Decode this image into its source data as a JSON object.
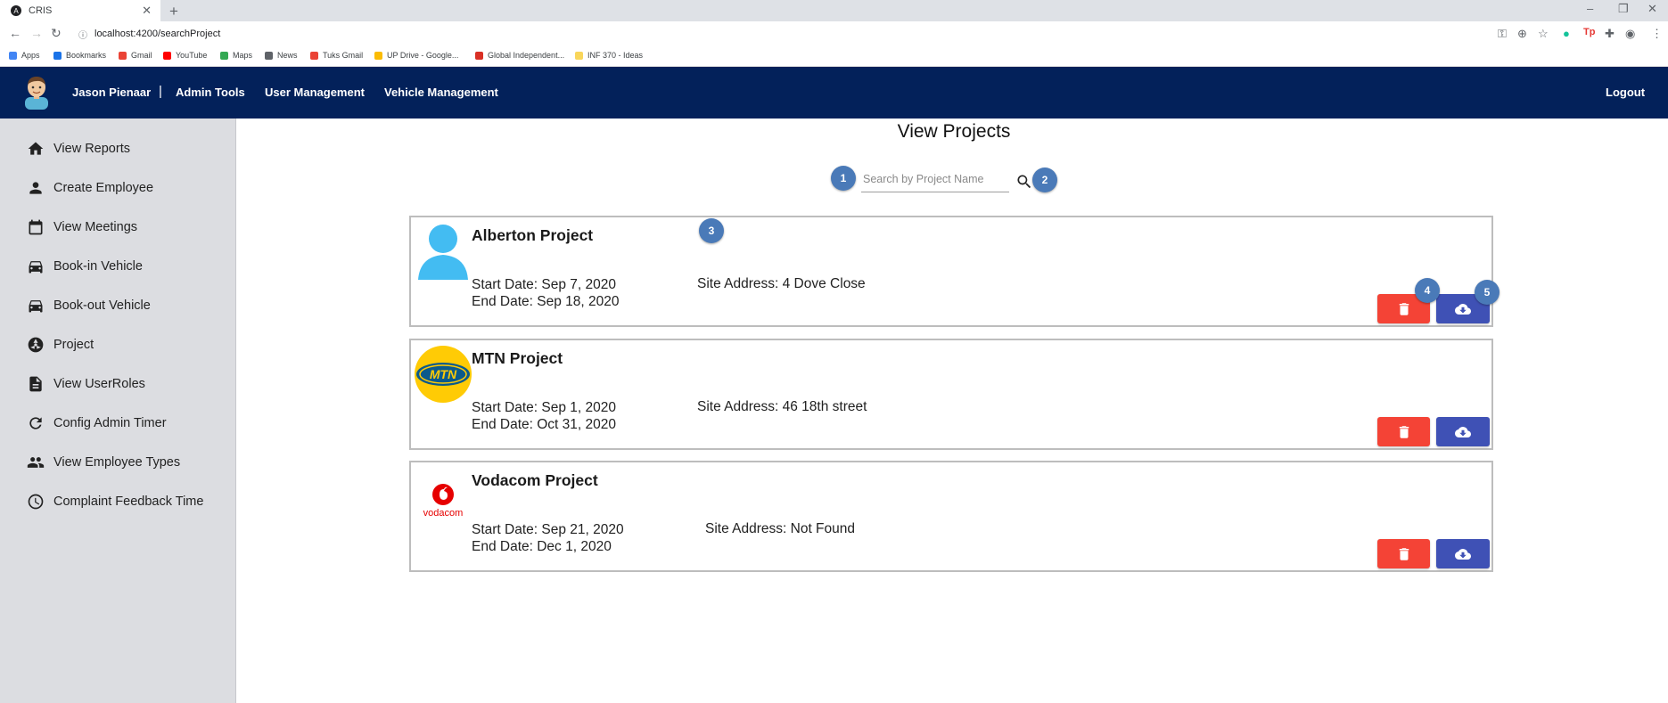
{
  "browser": {
    "tab_title": "CRIS",
    "url": "localhost:4200/searchProject",
    "bookmarks": [
      {
        "label": "Apps",
        "color": "#4285f4"
      },
      {
        "label": "Bookmarks",
        "color": "#1a73e8"
      },
      {
        "label": "Gmail",
        "color": "#ea4335"
      },
      {
        "label": "YouTube",
        "color": "#ff0000"
      },
      {
        "label": "Maps",
        "color": "#34a853"
      },
      {
        "label": "News",
        "color": "#5f6368"
      },
      {
        "label": "Tuks Gmail",
        "color": "#ea4335"
      },
      {
        "label": "UP Drive - Google...",
        "color": "#fbbc04"
      },
      {
        "label": "Global Independent...",
        "color": "#d93025"
      },
      {
        "label": "INF 370 - Ideas",
        "color": "#f9d65b"
      }
    ]
  },
  "header": {
    "user_name": "Jason Pienaar",
    "separator": "|",
    "nav": [
      "Admin Tools",
      "User Management",
      "Vehicle Management"
    ],
    "logout": "Logout",
    "bg_color": "#03215a"
  },
  "sidebar": {
    "items": [
      {
        "label": "View Reports",
        "icon": "home-icon"
      },
      {
        "label": "Create Employee",
        "icon": "person-icon"
      },
      {
        "label": "View Meetings",
        "icon": "calendar-icon"
      },
      {
        "label": "Book-in Vehicle",
        "icon": "car-icon"
      },
      {
        "label": "Book-out Vehicle",
        "icon": "car-icon"
      },
      {
        "label": "Project",
        "icon": "radioactive-icon"
      },
      {
        "label": "View UserRoles",
        "icon": "document-icon"
      },
      {
        "label": "Config Admin Timer",
        "icon": "refresh-icon"
      },
      {
        "label": "View Employee Types",
        "icon": "people-icon"
      },
      {
        "label": "Complaint Feedback Time",
        "icon": "clock-icon"
      }
    ]
  },
  "main": {
    "title": "View Projects",
    "search": {
      "placeholder": "Search by Project Name",
      "value": ""
    },
    "badges": [
      "1",
      "2",
      "3",
      "4",
      "5"
    ],
    "projects": [
      {
        "name": "Alberton Project",
        "start": "Start Date: Sep 7, 2020",
        "end": "End Date: Sep 18, 2020",
        "address": "Site Address: 4 Dove Close",
        "logo": "person-silhouette"
      },
      {
        "name": "MTN Project",
        "start": "Start Date: Sep 1, 2020",
        "end": "End Date: Oct 31, 2020",
        "address": "Site Address: 46 18th street",
        "logo": "mtn-logo",
        "logo_text": "MTN"
      },
      {
        "name": "Vodacom Project",
        "start": "Start Date: Sep 21, 2020",
        "end": "End Date: Dec 1, 2020",
        "address": "Site Address: Not Found",
        "logo": "vodacom-logo",
        "logo_text": "vodacom"
      }
    ],
    "delete_color": "#f44336",
    "download_color": "#3f51b5"
  }
}
